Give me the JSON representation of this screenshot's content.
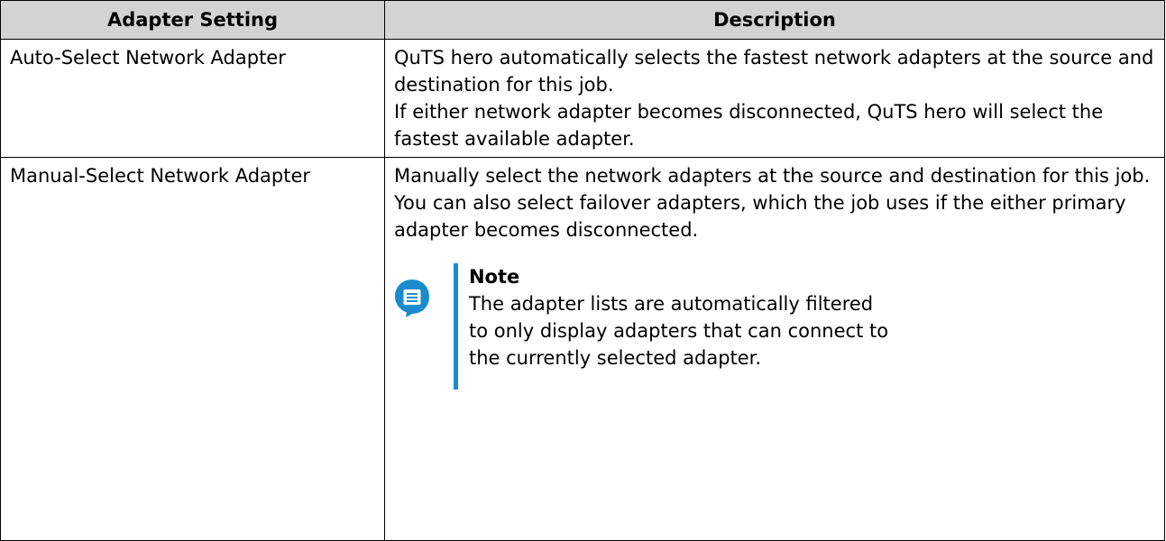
{
  "table": {
    "headers": [
      "Adapter Setting",
      "Description"
    ],
    "rows": [
      {
        "setting": "Auto-Select Network Adapter",
        "description": [
          "QuTS hero automatically selects the fastest network adapters at the source and destination for this job.",
          "If either network adapter becomes disconnected, QuTS hero will select the fastest available adapter."
        ]
      },
      {
        "setting": "Manual-Select Network Adapter",
        "description": [
          "Manually select the network adapters at the source and destination for this job. You can also select failover adapters, which the job uses if the either primary adapter becomes disconnected."
        ],
        "note": {
          "icon": "note-speech-bubble-icon",
          "title": "Note",
          "text": "The adapter lists are automatically filtered to only display adapters that can connect to the currently selected adapter."
        }
      }
    ]
  },
  "colors": {
    "header_bg": "#d3d3d3",
    "note_accent": "#1a8ccd"
  }
}
